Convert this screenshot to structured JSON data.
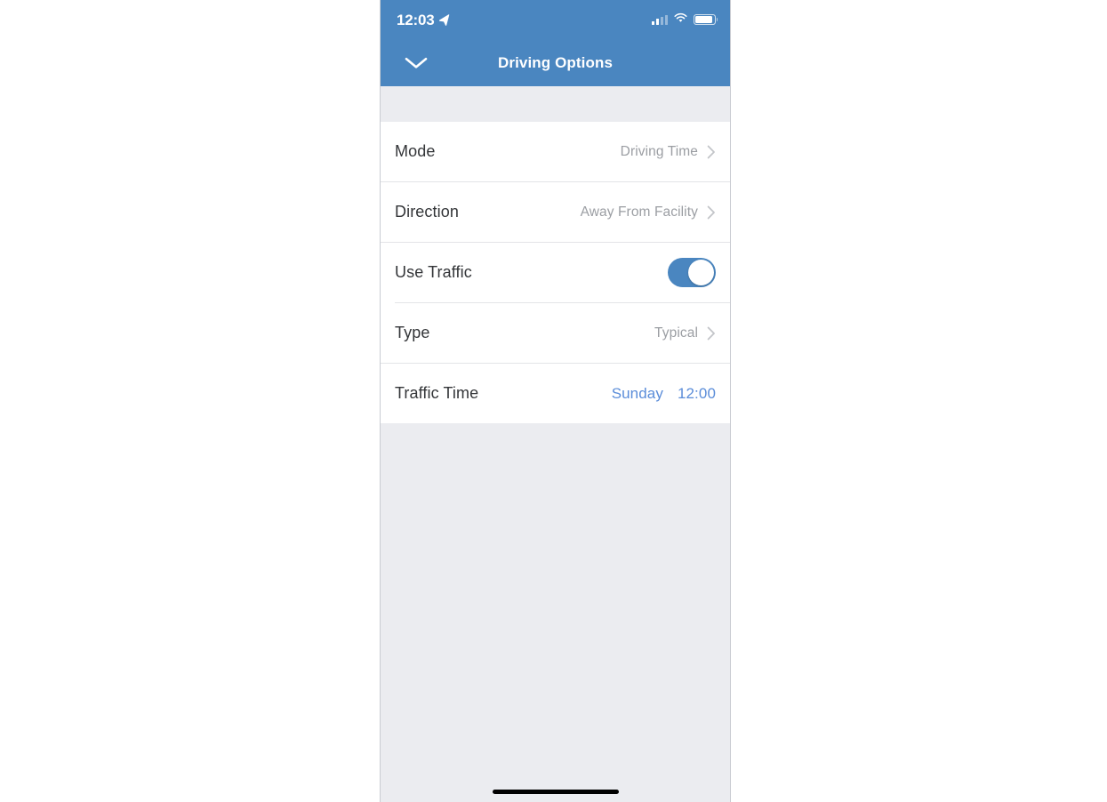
{
  "status_bar": {
    "time": "12:03",
    "location_icon": "location-arrow-icon",
    "signal_icon": "cellular-signal-icon",
    "signal_bars_filled": 2,
    "signal_bars_total": 4,
    "wifi_icon": "wifi-icon",
    "battery_icon": "battery-icon"
  },
  "header": {
    "title": "Driving Options",
    "collapse_icon": "chevron-down-icon",
    "background_color": "#4a86c0"
  },
  "rows": [
    {
      "label": "Mode",
      "value": "Driving Time",
      "control": "disclosure",
      "accessory_icon": "chevron-right-icon",
      "separator": "full"
    },
    {
      "label": "Direction",
      "value": "Away From Facility",
      "control": "disclosure",
      "accessory_icon": "chevron-right-icon",
      "separator": "full"
    },
    {
      "label": "Use Traffic",
      "value": "",
      "control": "toggle",
      "toggle_on": true,
      "separator": "inset"
    },
    {
      "label": "Type",
      "value": "Typical",
      "control": "disclosure",
      "accessory_icon": "chevron-right-icon",
      "separator": "full"
    },
    {
      "label": "Traffic Time",
      "control": "link-pair",
      "value_day": "Sunday",
      "value_time": "12:00",
      "separator": "none"
    }
  ],
  "colors": {
    "accent": "#4a86c0",
    "link": "#5b8dd9",
    "value_text": "#9b9ea3",
    "label_text": "#333538",
    "page_background": "#ebecf0",
    "card_background": "#ffffff",
    "separator": "#e3e4e7"
  },
  "home_indicator": "home-indicator"
}
